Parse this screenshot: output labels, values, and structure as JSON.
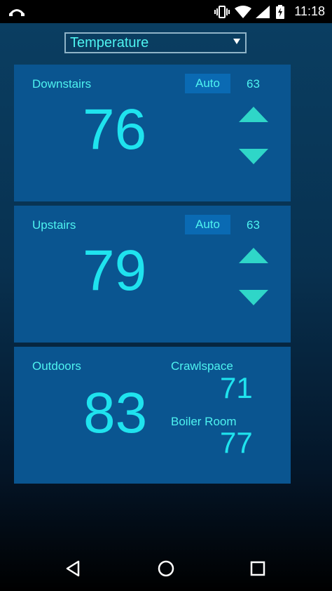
{
  "status_bar": {
    "time": "11:18",
    "icons": [
      "missed-call-icon",
      "vibrate-icon",
      "wifi-icon",
      "signal-icon",
      "battery-charging-icon"
    ]
  },
  "dropdown": {
    "selected": "Temperature"
  },
  "zones": [
    {
      "name": "Downstairs",
      "mode": "Auto",
      "setpoint": "63",
      "temperature": "76"
    },
    {
      "name": "Upstairs",
      "mode": "Auto",
      "setpoint": "63",
      "temperature": "79"
    }
  ],
  "outdoors": {
    "label": "Outdoors",
    "temperature": "83",
    "crawlspace": {
      "label": "Crawlspace",
      "temperature": "71"
    },
    "boiler_room": {
      "label": "Boiler Room",
      "temperature": "77"
    }
  },
  "nav_bar": {
    "buttons": [
      "back-icon",
      "home-icon",
      "recents-icon"
    ]
  },
  "colors": {
    "panel_bg": "#0a5590",
    "badge_bg": "#0a6ab3",
    "text_cyan": "#4ef3f0",
    "arrow": "#2fd6c8"
  }
}
